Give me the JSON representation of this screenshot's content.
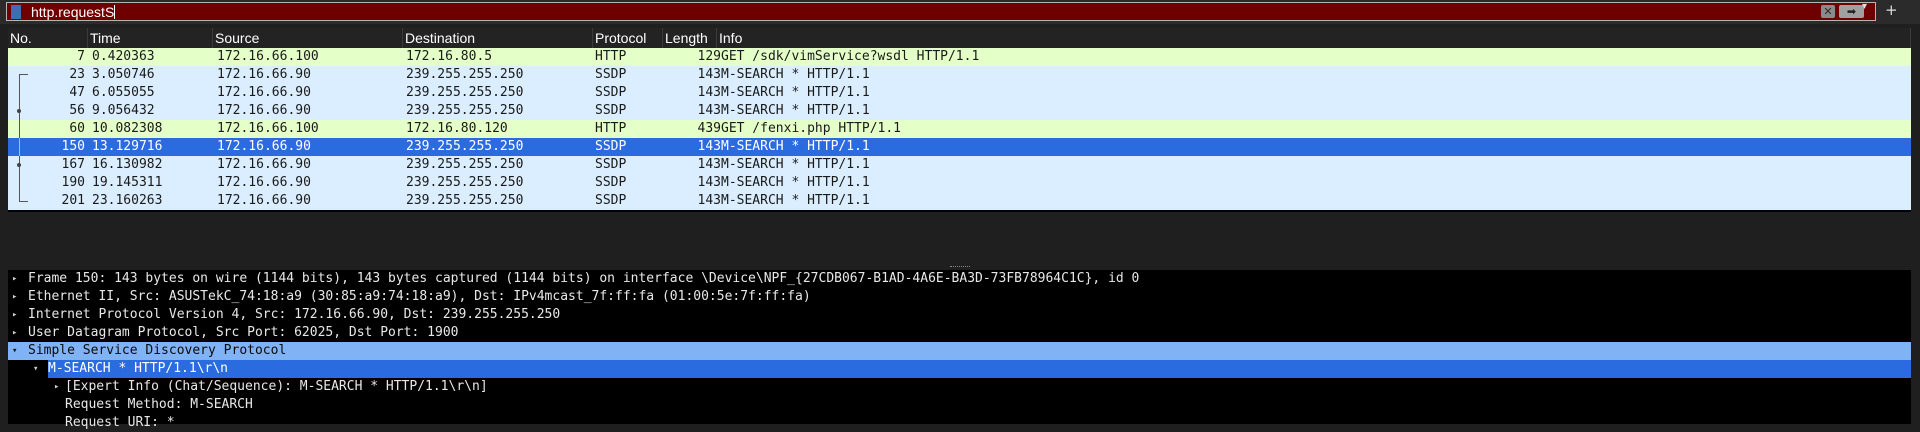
{
  "filter": {
    "text": "http.requestS"
  },
  "columns": {
    "no": "No.",
    "time": "Time",
    "source": "Source",
    "destination": "Destination",
    "protocol": "Protocol",
    "length": "Length",
    "info": "Info"
  },
  "packets": [
    {
      "no": "7",
      "time": "0.420363",
      "source": "172.16.66.100",
      "destination": "172.16.80.5",
      "protocol": "HTTP",
      "length": "129",
      "info": "GET /sdk/vimService?wsdl HTTP/1.1"
    },
    {
      "no": "23",
      "time": "3.050746",
      "source": "172.16.66.90",
      "destination": "239.255.255.250",
      "protocol": "SSDP",
      "length": "143",
      "info": "M-SEARCH * HTTP/1.1"
    },
    {
      "no": "47",
      "time": "6.055055",
      "source": "172.16.66.90",
      "destination": "239.255.255.250",
      "protocol": "SSDP",
      "length": "143",
      "info": "M-SEARCH * HTTP/1.1"
    },
    {
      "no": "56",
      "time": "9.056432",
      "source": "172.16.66.90",
      "destination": "239.255.255.250",
      "protocol": "SSDP",
      "length": "143",
      "info": "M-SEARCH * HTTP/1.1"
    },
    {
      "no": "60",
      "time": "10.082308",
      "source": "172.16.66.100",
      "destination": "172.16.80.120",
      "protocol": "HTTP",
      "length": "439",
      "info": "GET /fenxi.php HTTP/1.1"
    },
    {
      "no": "150",
      "time": "13.129716",
      "source": "172.16.66.90",
      "destination": "239.255.255.250",
      "protocol": "SSDP",
      "length": "143",
      "info": "M-SEARCH * HTTP/1.1"
    },
    {
      "no": "167",
      "time": "16.130982",
      "source": "172.16.66.90",
      "destination": "239.255.255.250",
      "protocol": "SSDP",
      "length": "143",
      "info": "M-SEARCH * HTTP/1.1"
    },
    {
      "no": "190",
      "time": "19.145311",
      "source": "172.16.66.90",
      "destination": "239.255.255.250",
      "protocol": "SSDP",
      "length": "143",
      "info": "M-SEARCH * HTTP/1.1"
    },
    {
      "no": "201",
      "time": "23.160263",
      "source": "172.16.66.90",
      "destination": "239.255.255.250",
      "protocol": "SSDP",
      "length": "143",
      "info": "M-SEARCH * HTTP/1.1"
    }
  ],
  "details": [
    "Frame 150: 143 bytes on wire (1144 bits), 143 bytes captured (1144 bits) on interface \\Device\\NPF_{27CDB067-B1AD-4A6E-BA3D-73FB78964C1C}, id 0",
    "Ethernet II, Src: ASUSTekC_74:18:a9 (30:85:a9:74:18:a9), Dst: IPv4mcast_7f:ff:fa (01:00:5e:7f:ff:fa)",
    "Internet Protocol Version 4, Src: 172.16.66.90, Dst: 239.255.255.250",
    "User Datagram Protocol, Src Port: 62025, Dst Port: 1900",
    "Simple Service Discovery Protocol",
    "M-SEARCH * HTTP/1.1\\r\\n",
    "[Expert Info (Chat/Sequence): M-SEARCH * HTTP/1.1\\r\\n]",
    "Request Method: M-SEARCH",
    "Request URI: *"
  ],
  "colors": {
    "filter_invalid_bg": "#6e0000",
    "http_row": "#e4ffc7",
    "ssdp_row": "#daeeff",
    "selected_row": "#2a6be0",
    "detail_highlight": "#7fb3f5"
  }
}
